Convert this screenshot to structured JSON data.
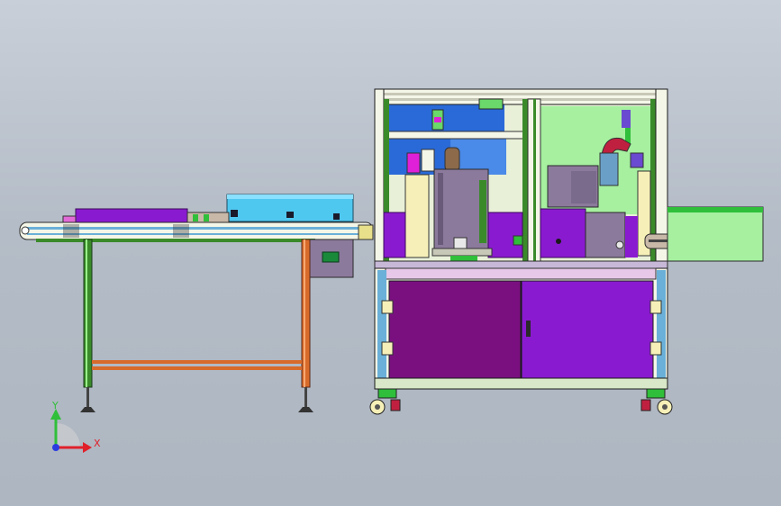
{
  "scene": {
    "background_top": "#c9cfd8",
    "background_bottom": "#aeb6c1"
  },
  "triad": {
    "x_label": "X",
    "y_label": "Y",
    "x_color": "#e0202a",
    "y_color": "#2fbf3a",
    "z_color": "#2a3be0"
  },
  "colors": {
    "frame_white": "#f4f6e8",
    "frame_green": "#3a8a2a",
    "conveyor_blue": "#4fc8f0",
    "purple": "#8a1ad0",
    "dark_purple": "#7a1080",
    "magenta": "#e020d8",
    "light_green": "#a6f0a0",
    "leg_orange": "#d86a2a",
    "panel_grey": "#8c7a9c",
    "royal_blue": "#2a6ad8",
    "cream": "#f6f0b8"
  }
}
